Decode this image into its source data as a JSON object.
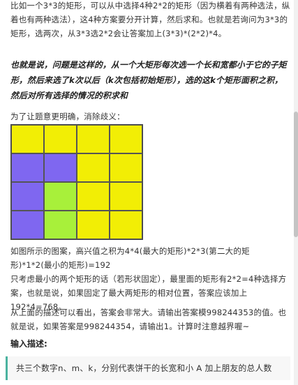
{
  "paragraphs": {
    "p1": "比如一个3*3的矩形，可以从中选择4种2*2的矩形（因为横着有两种选法，纵着也有两种选法），这4种方案要分开计算，然后求和。也就是若询问为3*3的矩形，选两次，从3*3选2*2会让答案加上(3*3)*(2*2)*4。",
    "emphasis": "也就是说，问题是这样的，从一个大矩形每次选一个长和宽都小于它的子矩形，然后来选了k次以后（k次包括初始矩形），选的这k个矩形面积之积，然后对所有选择的情况的积求和",
    "clarify": "为了让题意更明确，消除歧义：",
    "p3": "如图所示的图案，高兴值之积为4*4(最大的矩形)*2*3(第二大的矩形)*1*2(最小的矩形)=192",
    "p4": "只考虑最小的两个矩形的话（若形状固定），最里面的矩形有2*2=4种选择方案，也就是说，如果固定了最大两矩形的相对位置，答案应该加上192*4=768。",
    "p5": "从上面的描述可以看出，答案会非常大。请输出答案模998244353的值。也就是说，如果答案是998244354，请输出1。计算时注意越界喔~"
  },
  "section": {
    "input_heading": "输入描述:",
    "input_text": "共三个数字n、m、k，分别代表饼干的长宽和小 A 加上朋友的总人数"
  },
  "figure": {
    "grid": [
      [
        "yellow",
        "yellow",
        "yellow",
        "yellow"
      ],
      [
        "purple",
        "purple",
        "yellow",
        "yellow"
      ],
      [
        "purple",
        "green",
        "yellow",
        "yellow"
      ],
      [
        "purple",
        "green",
        "yellow",
        "yellow"
      ]
    ],
    "colors": {
      "yellow": "#f2ee05",
      "purple": "#7f67f0",
      "green": "#a8f03a"
    }
  }
}
